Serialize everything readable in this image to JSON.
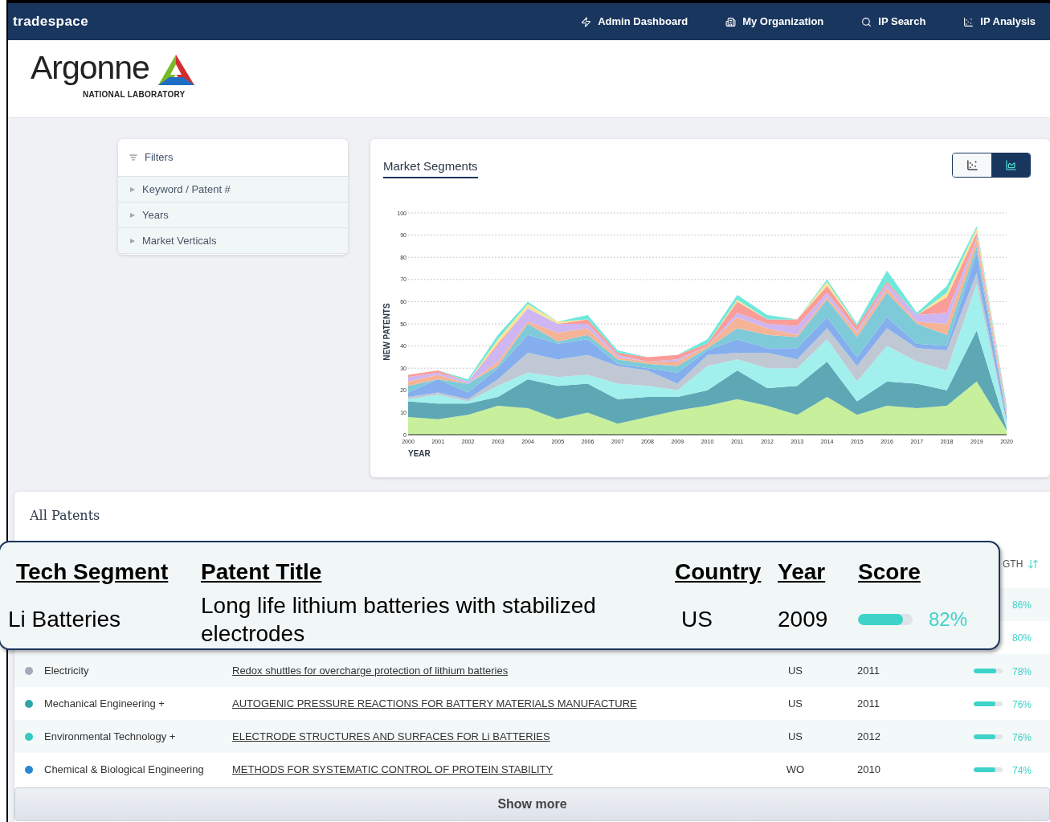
{
  "nav": {
    "brand": "tradespace",
    "links": [
      {
        "kind": "bolt",
        "label": "Admin Dashboard"
      },
      {
        "kind": "building",
        "label": "My Organization"
      },
      {
        "kind": "search",
        "label": "IP Search"
      },
      {
        "kind": "analysis",
        "label": "IP Analysis"
      }
    ]
  },
  "logo": {
    "name": "Argonne",
    "subtitle": "NATIONAL LABORATORY"
  },
  "filters": {
    "title": "Filters",
    "items": [
      {
        "label": "Keyword / Patent #",
        "expanded": false
      },
      {
        "label": "Years",
        "expanded": false
      },
      {
        "label": "Market Verticals",
        "expanded": false
      }
    ]
  },
  "market": {
    "title": "Market Segments",
    "views": [
      {
        "kind": "scatter",
        "selected": false
      },
      {
        "kind": "area",
        "selected": true
      }
    ],
    "chart_data": {
      "type": "area",
      "stacked": true,
      "grid": true,
      "xlim": [
        2000,
        2020
      ],
      "xlabel": "YEAR",
      "ylabel": "NEW PATENTS",
      "x": [
        2000,
        2001,
        2002,
        2003,
        2004,
        2005,
        2006,
        2007,
        2008,
        2009,
        2010,
        2011,
        2012,
        2013,
        2014,
        2015,
        2016,
        2017,
        2018,
        2019,
        2020
      ],
      "ylim": [
        0,
        100
      ],
      "yticks": [
        0,
        10,
        20,
        30,
        40,
        50,
        60,
        70,
        80,
        90,
        100
      ],
      "xticks": [
        2000,
        2001,
        2002,
        2003,
        2004,
        2005,
        2006,
        2007,
        2008,
        2009,
        2010,
        2011,
        2012,
        2013,
        2014,
        2015,
        2016,
        2017,
        2018,
        2019,
        2020
      ],
      "series": [
        {
          "color": "#c8f09c",
          "values": [
            8,
            7,
            9,
            13,
            12,
            7,
            10,
            5,
            8,
            11,
            13,
            16,
            13,
            9,
            17,
            9,
            13,
            12,
            13,
            24,
            2
          ]
        },
        {
          "color": "#5ea8b5",
          "values": [
            7,
            7,
            5,
            4,
            13,
            15,
            13,
            11,
            9,
            6,
            7,
            13,
            8,
            13,
            16,
            6,
            11,
            11,
            7,
            23,
            1
          ]
        },
        {
          "color": "#a2f0ee",
          "values": [
            1,
            4,
            1,
            5,
            3,
            4,
            4,
            7,
            5,
            3,
            11,
            5,
            9,
            8,
            10,
            9,
            16,
            10,
            9,
            21,
            2
          ]
        },
        {
          "color": "#c0c8d4",
          "values": [
            1,
            1,
            1,
            3,
            9,
            8,
            9,
            8,
            7,
            3,
            5,
            3,
            7,
            4,
            5,
            7,
            8,
            6,
            9,
            5,
            1
          ]
        },
        {
          "color": "#84aeee",
          "values": [
            2,
            6,
            3,
            5,
            8,
            7,
            7,
            1,
            1,
            5,
            2,
            6,
            2,
            5,
            5,
            4,
            5,
            2,
            2,
            9,
            2
          ]
        },
        {
          "color": "#7ecad8",
          "values": [
            3,
            0,
            4,
            1,
            5,
            1,
            2,
            2,
            2,
            3,
            1,
            5,
            6,
            5,
            8,
            9,
            11,
            9,
            5,
            3,
            1
          ]
        },
        {
          "color": "#f6b496",
          "values": [
            2,
            2,
            0,
            2,
            1,
            4,
            3,
            1,
            1,
            2,
            1,
            5,
            3,
            1,
            1,
            2,
            2,
            1,
            5,
            3,
            1
          ]
        },
        {
          "color": "#cdb6f2",
          "values": [
            2,
            1,
            1,
            7,
            6,
            4,
            2,
            1,
            0,
            1,
            0,
            2,
            2,
            4,
            2,
            1,
            2,
            3,
            5,
            1,
            1
          ]
        },
        {
          "color": "#fa9c98",
          "values": [
            1,
            1,
            0,
            1,
            0,
            0,
            2,
            1,
            2,
            2,
            1,
            5,
            2,
            3,
            3,
            2,
            1,
            0,
            7,
            2,
            1
          ]
        },
        {
          "color": "#f8e49a",
          "values": [
            0,
            0,
            0,
            2,
            2,
            1,
            0,
            0,
            0,
            0,
            0,
            1,
            0,
            0,
            2,
            0,
            0,
            0,
            2,
            2,
            0
          ]
        },
        {
          "color": "#6ee8dc",
          "values": [
            0,
            0,
            1,
            2,
            1,
            0,
            2,
            1,
            0,
            0,
            2,
            2,
            2,
            0,
            1,
            1,
            5,
            1,
            3,
            1,
            1
          ]
        }
      ]
    }
  },
  "patents": {
    "title": "All Patents",
    "partial_header": "GTH",
    "callout": {
      "columns": [
        "Tech Segment",
        "Patent Title",
        "Country",
        "Year",
        "Score"
      ],
      "row": {
        "segment": "Li Batteries",
        "title": "Long life lithium batteries with stabilized electrodes",
        "country": "US",
        "year": "2009",
        "level": 0.82,
        "score": "82%"
      }
    },
    "covered_rows": [
      {
        "score": "86%"
      },
      {
        "score": "80%"
      }
    ],
    "rows": [
      {
        "segment": "Electricity",
        "color": "#a4abb8",
        "title": "Redox shuttles for overcharge protection of lithium batteries",
        "country": "US",
        "year": "2011",
        "level": 0.78,
        "score": "78%"
      },
      {
        "segment": "Mechanical Engineering +",
        "color": "#2ea5a8",
        "title": "AUTOGENIC PRESSURE REACTIONS FOR BATTERY MATERIALS MANUFACTURE",
        "country": "US",
        "year": "2011",
        "level": 0.76,
        "score": "76%"
      },
      {
        "segment": "Environmental Technology +",
        "color": "#37c8c0",
        "title": "ELECTRODE STRUCTURES AND SURFACES FOR Li BATTERIES",
        "country": "US",
        "year": "2012",
        "level": 0.76,
        "score": "76%"
      },
      {
        "segment": "Chemical & Biological Engineering",
        "color": "#2c86d0",
        "title": "METHODS FOR SYSTEMATIC CONTROL OF PROTEIN STABILITY",
        "country": "WO",
        "year": "2010",
        "level": 0.74,
        "score": "74%"
      }
    ],
    "show_more": "Show more"
  }
}
